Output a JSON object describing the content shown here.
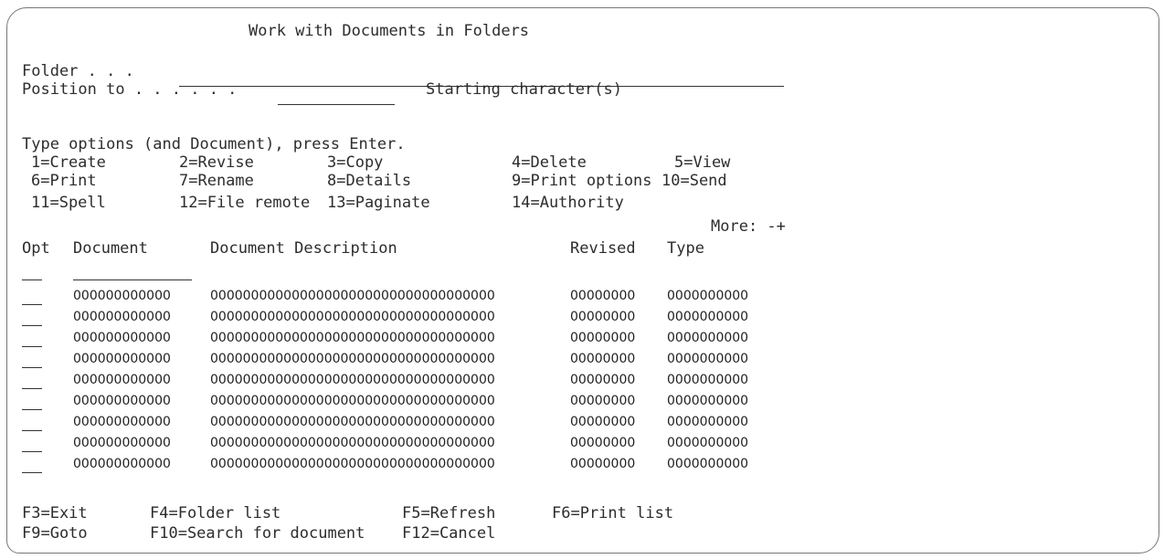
{
  "screen_title": "Work with Documents in Folders",
  "folder": {
    "label": "Folder . . .",
    "value": ""
  },
  "position_to": {
    "label": "Position to . . . . . .",
    "value": "",
    "suffix": "Starting character(s)"
  },
  "instructions": "Type options (and Document), press Enter.",
  "options": [
    [
      "1=Create",
      "2=Revise",
      "3=Copy",
      "4=Delete",
      "5=View"
    ],
    [
      "6=Print",
      "7=Rename",
      "8=Details",
      "9=Print options",
      "10=Send"
    ],
    [
      "11=Spell",
      "12=File remote",
      "13=Paginate",
      "14=Authority"
    ]
  ],
  "more_indicator": "More: -+",
  "columns": {
    "opt": "Opt",
    "document": "Document",
    "description": "Document Description",
    "revised": "Revised",
    "type": "Type"
  },
  "filter_row": {
    "opt": "",
    "document": ""
  },
  "rows": [
    {
      "opt": "",
      "document": "000000000000",
      "description": "00000000000000000000000000000000000",
      "revised": "00000000",
      "type": "0000000000"
    },
    {
      "opt": "",
      "document": "000000000000",
      "description": "00000000000000000000000000000000000",
      "revised": "00000000",
      "type": "0000000000"
    },
    {
      "opt": "",
      "document": "000000000000",
      "description": "00000000000000000000000000000000000",
      "revised": "00000000",
      "type": "0000000000"
    },
    {
      "opt": "",
      "document": "000000000000",
      "description": "00000000000000000000000000000000000",
      "revised": "00000000",
      "type": "0000000000"
    },
    {
      "opt": "",
      "document": "000000000000",
      "description": "00000000000000000000000000000000000",
      "revised": "00000000",
      "type": "0000000000"
    },
    {
      "opt": "",
      "document": "000000000000",
      "description": "00000000000000000000000000000000000",
      "revised": "00000000",
      "type": "0000000000"
    },
    {
      "opt": "",
      "document": "000000000000",
      "description": "00000000000000000000000000000000000",
      "revised": "00000000",
      "type": "0000000000"
    },
    {
      "opt": "",
      "document": "000000000000",
      "description": "00000000000000000000000000000000000",
      "revised": "00000000",
      "type": "0000000000"
    },
    {
      "opt": "",
      "document": "000000000000",
      "description": "00000000000000000000000000000000000",
      "revised": "00000000",
      "type": "0000000000"
    }
  ],
  "function_keys": [
    [
      "F3=Exit",
      "F4=Folder list",
      "F5=Refresh",
      "F6=Print list"
    ],
    [
      "F9=Goto",
      "F10=Search for document",
      "F12=Cancel"
    ]
  ]
}
